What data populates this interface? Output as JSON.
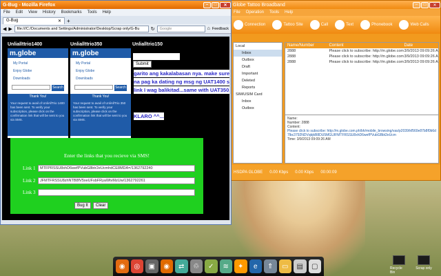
{
  "firefox": {
    "title": "G-Bug - Mozilla Firefox",
    "menu": [
      "File",
      "Edit",
      "View",
      "History",
      "Bookmarks",
      "Tools",
      "Help"
    ],
    "tab": "G-Bug",
    "url": "file:///C:/Documents and Settings/Administrator/Desktop/Scrap only/G-Bu",
    "search_placeholder": "Google",
    "feedback": "Feedback",
    "page": {
      "col1_title": "Unliallttrio1400",
      "col2_title": "Unliallttrio350",
      "col3_title": "Unlialltrio150",
      "logo": "m.globe",
      "links": [
        "My Portal",
        "Enjoy Globe",
        "Downloads"
      ],
      "search_button": "Search",
      "thank_you": "Thank You!",
      "col1_message": "Your request to avail of UnliAllTrio 1400 has been sent. To verify your subscription, please click on the confirmation link that will be sent to you via SMS.",
      "col2_message": "Your request to avail of UnliAllTrio 350 has been sent. To verify your subscription, please click on the confirmation link that will be sent to you via SMS.",
      "submit_button": "Submit",
      "blue_lines": [
        "garito ang kakalabasan nya. make sure",
        "na pag ka dating ng msg ng UAT1400 sa",
        "link I wag balikitad...same with UAT350..",
        "",
        "KLARO ^^..."
      ],
      "form_title": "Enter the links that you recieve via SMS!",
      "link1_label": "Link 1",
      "link1_value": "MTFPRSSU8xhD6wefPVubG8btr2eUcmhdCE8MDA=/1362792240",
      "link2_label": "Link 2",
      "link2_value": "JFMTFRSSU8zhNTB8fV5xeUFsbFRyaWtvMzUw/1362792261",
      "link3_label": "Link 3",
      "link3_value": "",
      "bug_button": "Bug It",
      "clear_button": "Clear"
    }
  },
  "globe": {
    "title": "Globe Tattoo Broadband",
    "menu": [
      "File",
      "Operation",
      "Tools",
      "Help"
    ],
    "toolbar": [
      "Connection",
      "Tattoo Site",
      "Call",
      "Text",
      "Phonebook",
      "Web Calls"
    ],
    "tree": [
      "Local",
      "Inbox",
      "Outbox",
      "Draft",
      "Important",
      "Deleted",
      "Reports",
      "SIM/USIM Card",
      "Inbox",
      "Outbox"
    ],
    "columns": [
      "Name/Number",
      "Content",
      "Date"
    ],
    "rows": [
      {
        "name": "2888",
        "content": "Please click to subscribe: http://m.globe.com.ph/t...",
        "date": "3/9/2013 09:09:26 AM"
      },
      {
        "name": "2888",
        "content": "Please click to subscribe: http://m.globe.com.ph/t...",
        "date": "3/9/2013 09:09:26 AM"
      },
      {
        "name": "2888",
        "content": "Please click to subscribe: http://m.globe.com.ph/t...",
        "date": "3/9/2013 09:09:26 AM"
      }
    ],
    "detail": {
      "name_label": "Name:",
      "number_label": "Number: 2888",
      "content_label": "Content:",
      "content": "Please click to subscribe: http://m.globe.com.ph/bh/mobile_browsing/vas/p2039/kf560e87b8f0b6d7lbc3792NDVqbjkB8DU5MGUIFMTFRSSU8xhD6wefPVubGBbt2eUcm",
      "time": "Time: 3/9/2013 09:09:26 AM"
    },
    "status": {
      "network": "HSDPA GLOBE",
      "signal": "",
      "down": "0.00 Kbps",
      "up": "0.00 Kbps",
      "time": "00:00:09"
    }
  },
  "desktop": {
    "recycle": "Recycle Bin",
    "scrap": "Scrap only"
  },
  "colors": {
    "firefox_orange": "#e06a00",
    "globe_orange": "#f29a1e",
    "green": "#1fd01f",
    "mglobe_blue": "#1f5ba8"
  }
}
